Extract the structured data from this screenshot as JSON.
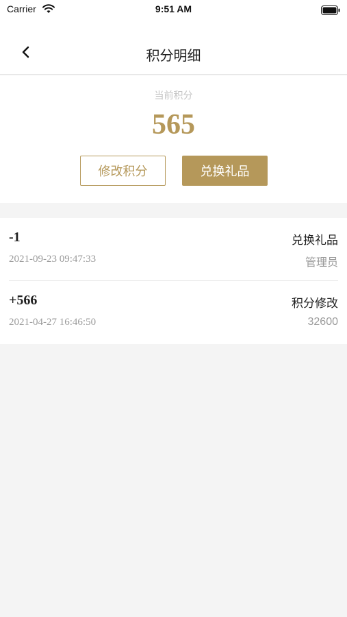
{
  "status_bar": {
    "carrier": "Carrier",
    "time": "9:51 AM"
  },
  "nav": {
    "title": "积分明细"
  },
  "summary": {
    "label": "当前积分",
    "points": "565",
    "modify_button": "修改积分",
    "exchange_button": "兑换礼品"
  },
  "records": [
    {
      "amount": "-1",
      "time": "2021-09-23 09:47:33",
      "type": "兑换礼品",
      "operator": "管理员"
    },
    {
      "amount": "+566",
      "time": "2021-04-27 16:46:50",
      "type": "积分修改",
      "operator": "32600"
    }
  ],
  "colors": {
    "accent": "#b5985a",
    "background": "#f4f4f4"
  }
}
